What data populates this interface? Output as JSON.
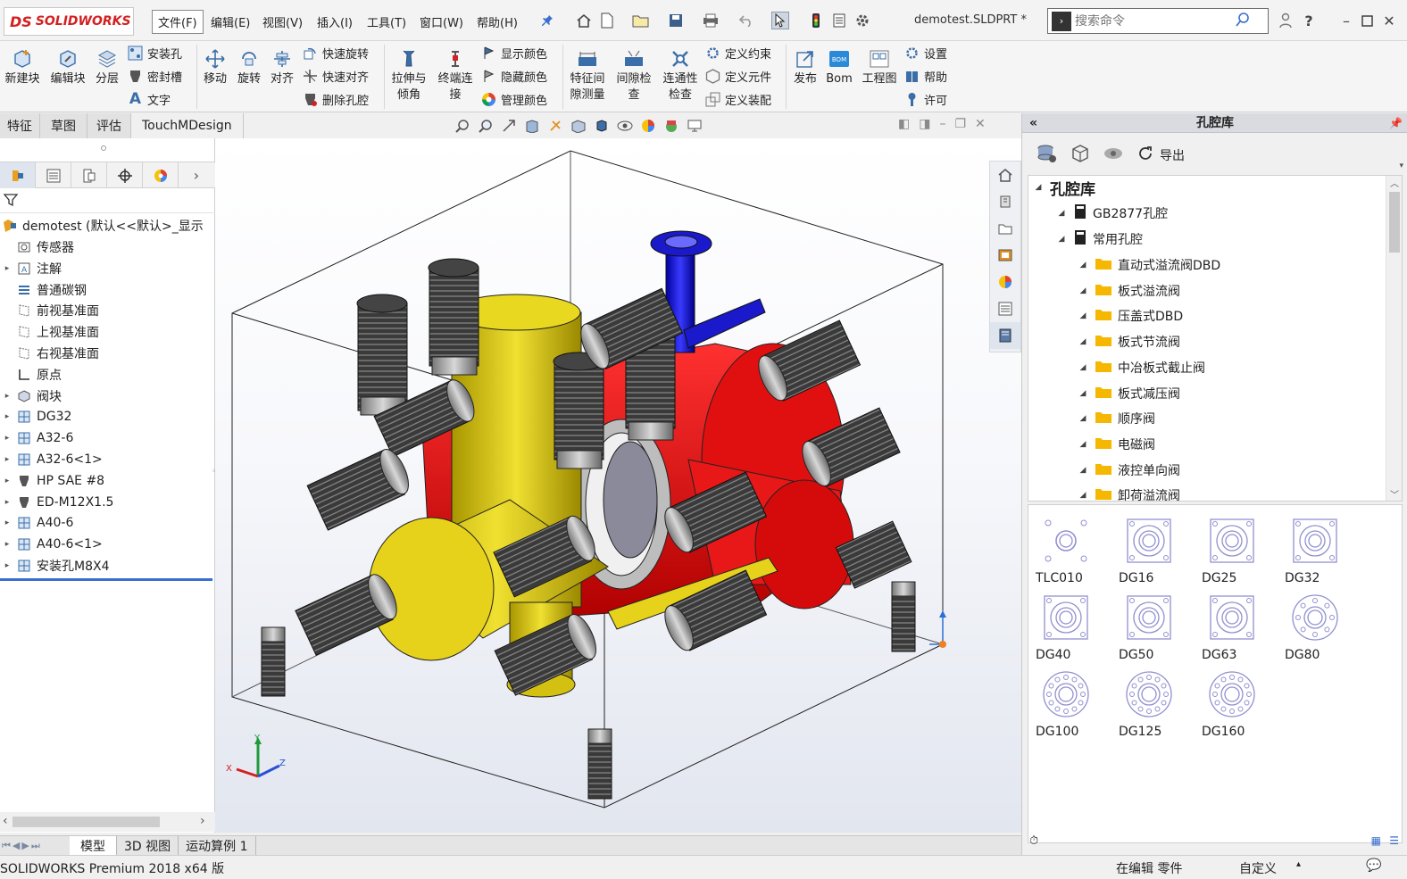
{
  "app": {
    "logo_prefix": "DS",
    "logo_text": "SOLIDWORKS",
    "document_title": "demotest.SLDPRT *"
  },
  "menu": [
    {
      "label": "文件(F)"
    },
    {
      "label": "编辑(E)"
    },
    {
      "label": "视图(V)"
    },
    {
      "label": "插入(I)"
    },
    {
      "label": "工具(T)"
    },
    {
      "label": "窗口(W)"
    },
    {
      "label": "帮助(H)"
    }
  ],
  "search": {
    "placeholder": "搜索命令"
  },
  "commands": {
    "new_block": "新建块",
    "edit_block": "编辑块",
    "layer": "分层",
    "mount_hole": "安装孔",
    "seal_groove": "密封槽",
    "text": "文字",
    "move": "移动",
    "rotate": "旋转",
    "align": "对齐",
    "quick_rotate": "快速旋转",
    "quick_align": "快速对齐",
    "delete_cavity": "删除孔腔",
    "extrude_line1": "拉伸与",
    "extrude_line2": "倾角",
    "endpoint_line1": "终端连",
    "endpoint_line2": "接",
    "show_color": "显示颜色",
    "hide_color": "隐藏颜色",
    "manage_color": "管理颜色",
    "feature_line1": "特征间",
    "feature_line2": "隙测量",
    "gap_line1": "间隙检",
    "gap_line2": "查",
    "connect_line1": "连通性",
    "connect_line2": "检查",
    "define_constraint": "定义约束",
    "define_element": "定义元件",
    "define_assembly": "定义装配",
    "publish": "发布",
    "bom": "Bom",
    "drawing": "工程图",
    "settings": "设置",
    "help": "帮助",
    "license": "许可"
  },
  "tabs": [
    {
      "label": "特征"
    },
    {
      "label": "草图"
    },
    {
      "label": "评估"
    },
    {
      "label": "TouchMDesign"
    }
  ],
  "feature_tree": {
    "root": "demotest  (默认<<默认>_显示",
    "items": [
      {
        "label": "传感器",
        "expandable": false
      },
      {
        "label": "注解",
        "expandable": true
      },
      {
        "label": "普通碳钢",
        "expandable": false
      },
      {
        "label": "前视基准面",
        "expandable": false
      },
      {
        "label": "上视基准面",
        "expandable": false
      },
      {
        "label": "右视基准面",
        "expandable": false
      },
      {
        "label": "原点",
        "expandable": false
      },
      {
        "label": "阀块",
        "expandable": true
      },
      {
        "label": "DG32",
        "expandable": true
      },
      {
        "label": "A32-6",
        "expandable": true
      },
      {
        "label": "A32-6<1>",
        "expandable": true
      },
      {
        "label": "HP SAE #8",
        "expandable": true
      },
      {
        "label": "ED-M12X1.5",
        "expandable": true
      },
      {
        "label": "A40-6",
        "expandable": true
      },
      {
        "label": "A40-6<1>",
        "expandable": true
      },
      {
        "label": "安装孔M8X4",
        "expandable": true
      }
    ]
  },
  "right_panel": {
    "title": "孔腔库",
    "export_label": "导出",
    "tree_root": "孔腔库",
    "libraries": [
      {
        "label": "GB2877孔腔"
      },
      {
        "label": "常用孔腔"
      }
    ],
    "folders": [
      {
        "label": "直动式溢流阀DBD"
      },
      {
        "label": "板式溢流阀"
      },
      {
        "label": "压盖式DBD"
      },
      {
        "label": "板式节流阀"
      },
      {
        "label": "中冶板式截止阀"
      },
      {
        "label": "板式减压阀"
      },
      {
        "label": "顺序阀"
      },
      {
        "label": "电磁阀"
      },
      {
        "label": "液控单向阀"
      },
      {
        "label": "卸荷溢流阀"
      }
    ],
    "gallery": [
      {
        "label": "TLC010"
      },
      {
        "label": "DG16"
      },
      {
        "label": "DG25"
      },
      {
        "label": "DG32"
      },
      {
        "label": "DG40"
      },
      {
        "label": "DG50"
      },
      {
        "label": "DG63"
      },
      {
        "label": "DG80"
      },
      {
        "label": "DG100"
      },
      {
        "label": "DG125"
      },
      {
        "label": "DG160"
      }
    ]
  },
  "bottom_tabs": [
    {
      "label": "模型"
    },
    {
      "label": "3D 视图"
    },
    {
      "label": "运动算例 1"
    }
  ],
  "status": {
    "left": "SOLIDWORKS Premium 2018 x64 版",
    "editing": "在编辑 零件",
    "units": "自定义"
  },
  "triad": {
    "x": "X",
    "y": "Y",
    "z": "Z"
  },
  "colors": {
    "cavity_red": "#e01010",
    "cavity_yellow": "#e6d21a",
    "cavity_blue": "#1a1acc",
    "thread_gray": "#3c3c3c",
    "folder": "#f5b700",
    "brand_red": "#d42020"
  }
}
